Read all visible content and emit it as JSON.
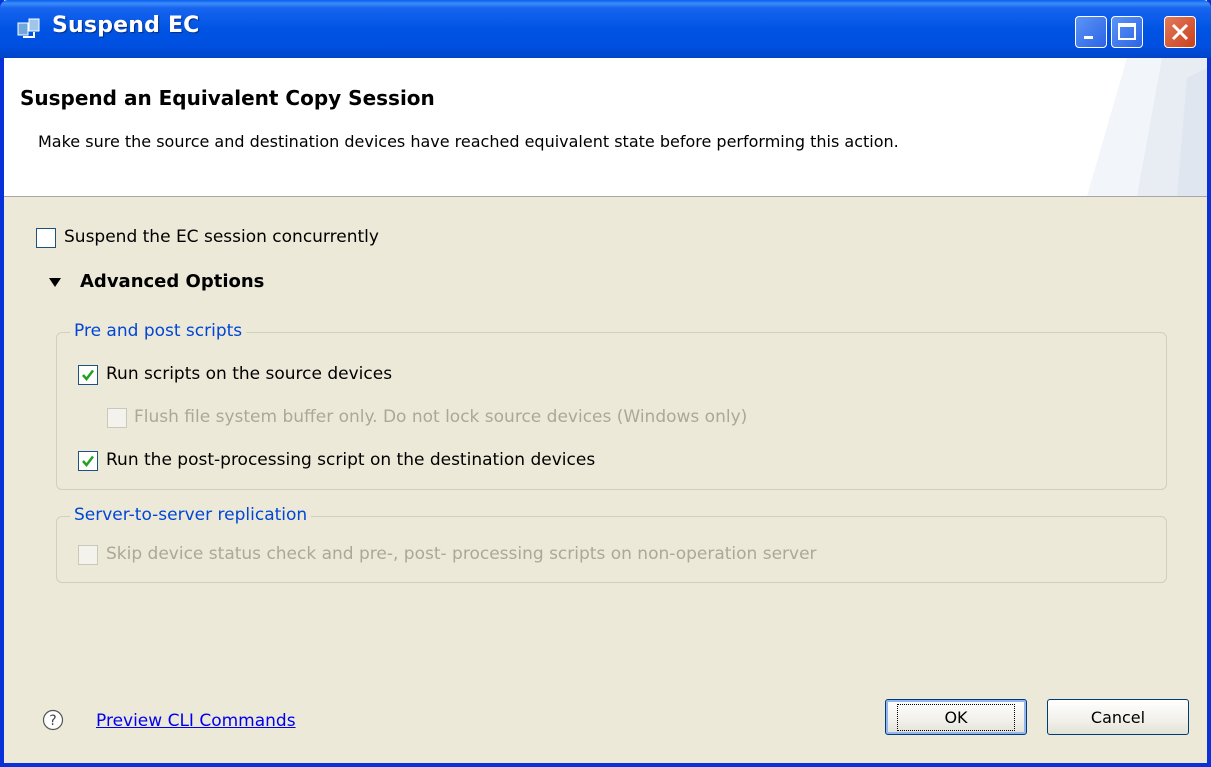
{
  "window": {
    "title": "Suspend EC"
  },
  "header": {
    "title": "Suspend an Equivalent Copy Session",
    "description": "Make sure the source and destination devices have reached equivalent state before performing this action."
  },
  "options": {
    "concurrent": {
      "label": "Suspend the EC session concurrently",
      "checked": false
    }
  },
  "advanced": {
    "label": "Advanced Options",
    "expanded": true,
    "scripts_group": {
      "title": "Pre and post scripts",
      "run_source": {
        "label": "Run scripts on the source devices",
        "checked": true,
        "enabled": true
      },
      "flush_only": {
        "label": "Flush file system buffer only. Do not lock source devices (Windows only)",
        "checked": false,
        "enabled": false
      },
      "run_post": {
        "label": "Run the post-processing script on the destination devices",
        "checked": true,
        "enabled": true
      }
    },
    "replication_group": {
      "title": "Server-to-server replication",
      "skip_check": {
        "label": "Skip device status check and pre-, post- processing scripts on non-operation server",
        "checked": false,
        "enabled": false
      }
    }
  },
  "footer": {
    "help_icon": "question-circle-icon",
    "preview_link": "Preview CLI Commands",
    "ok_label": "OK",
    "cancel_label": "Cancel"
  },
  "colors": {
    "titlebar": "#0054e3",
    "dialog_bg": "#ece9d8",
    "group_title": "#0046d5",
    "check": "#21a121",
    "link": "#0000ee"
  }
}
